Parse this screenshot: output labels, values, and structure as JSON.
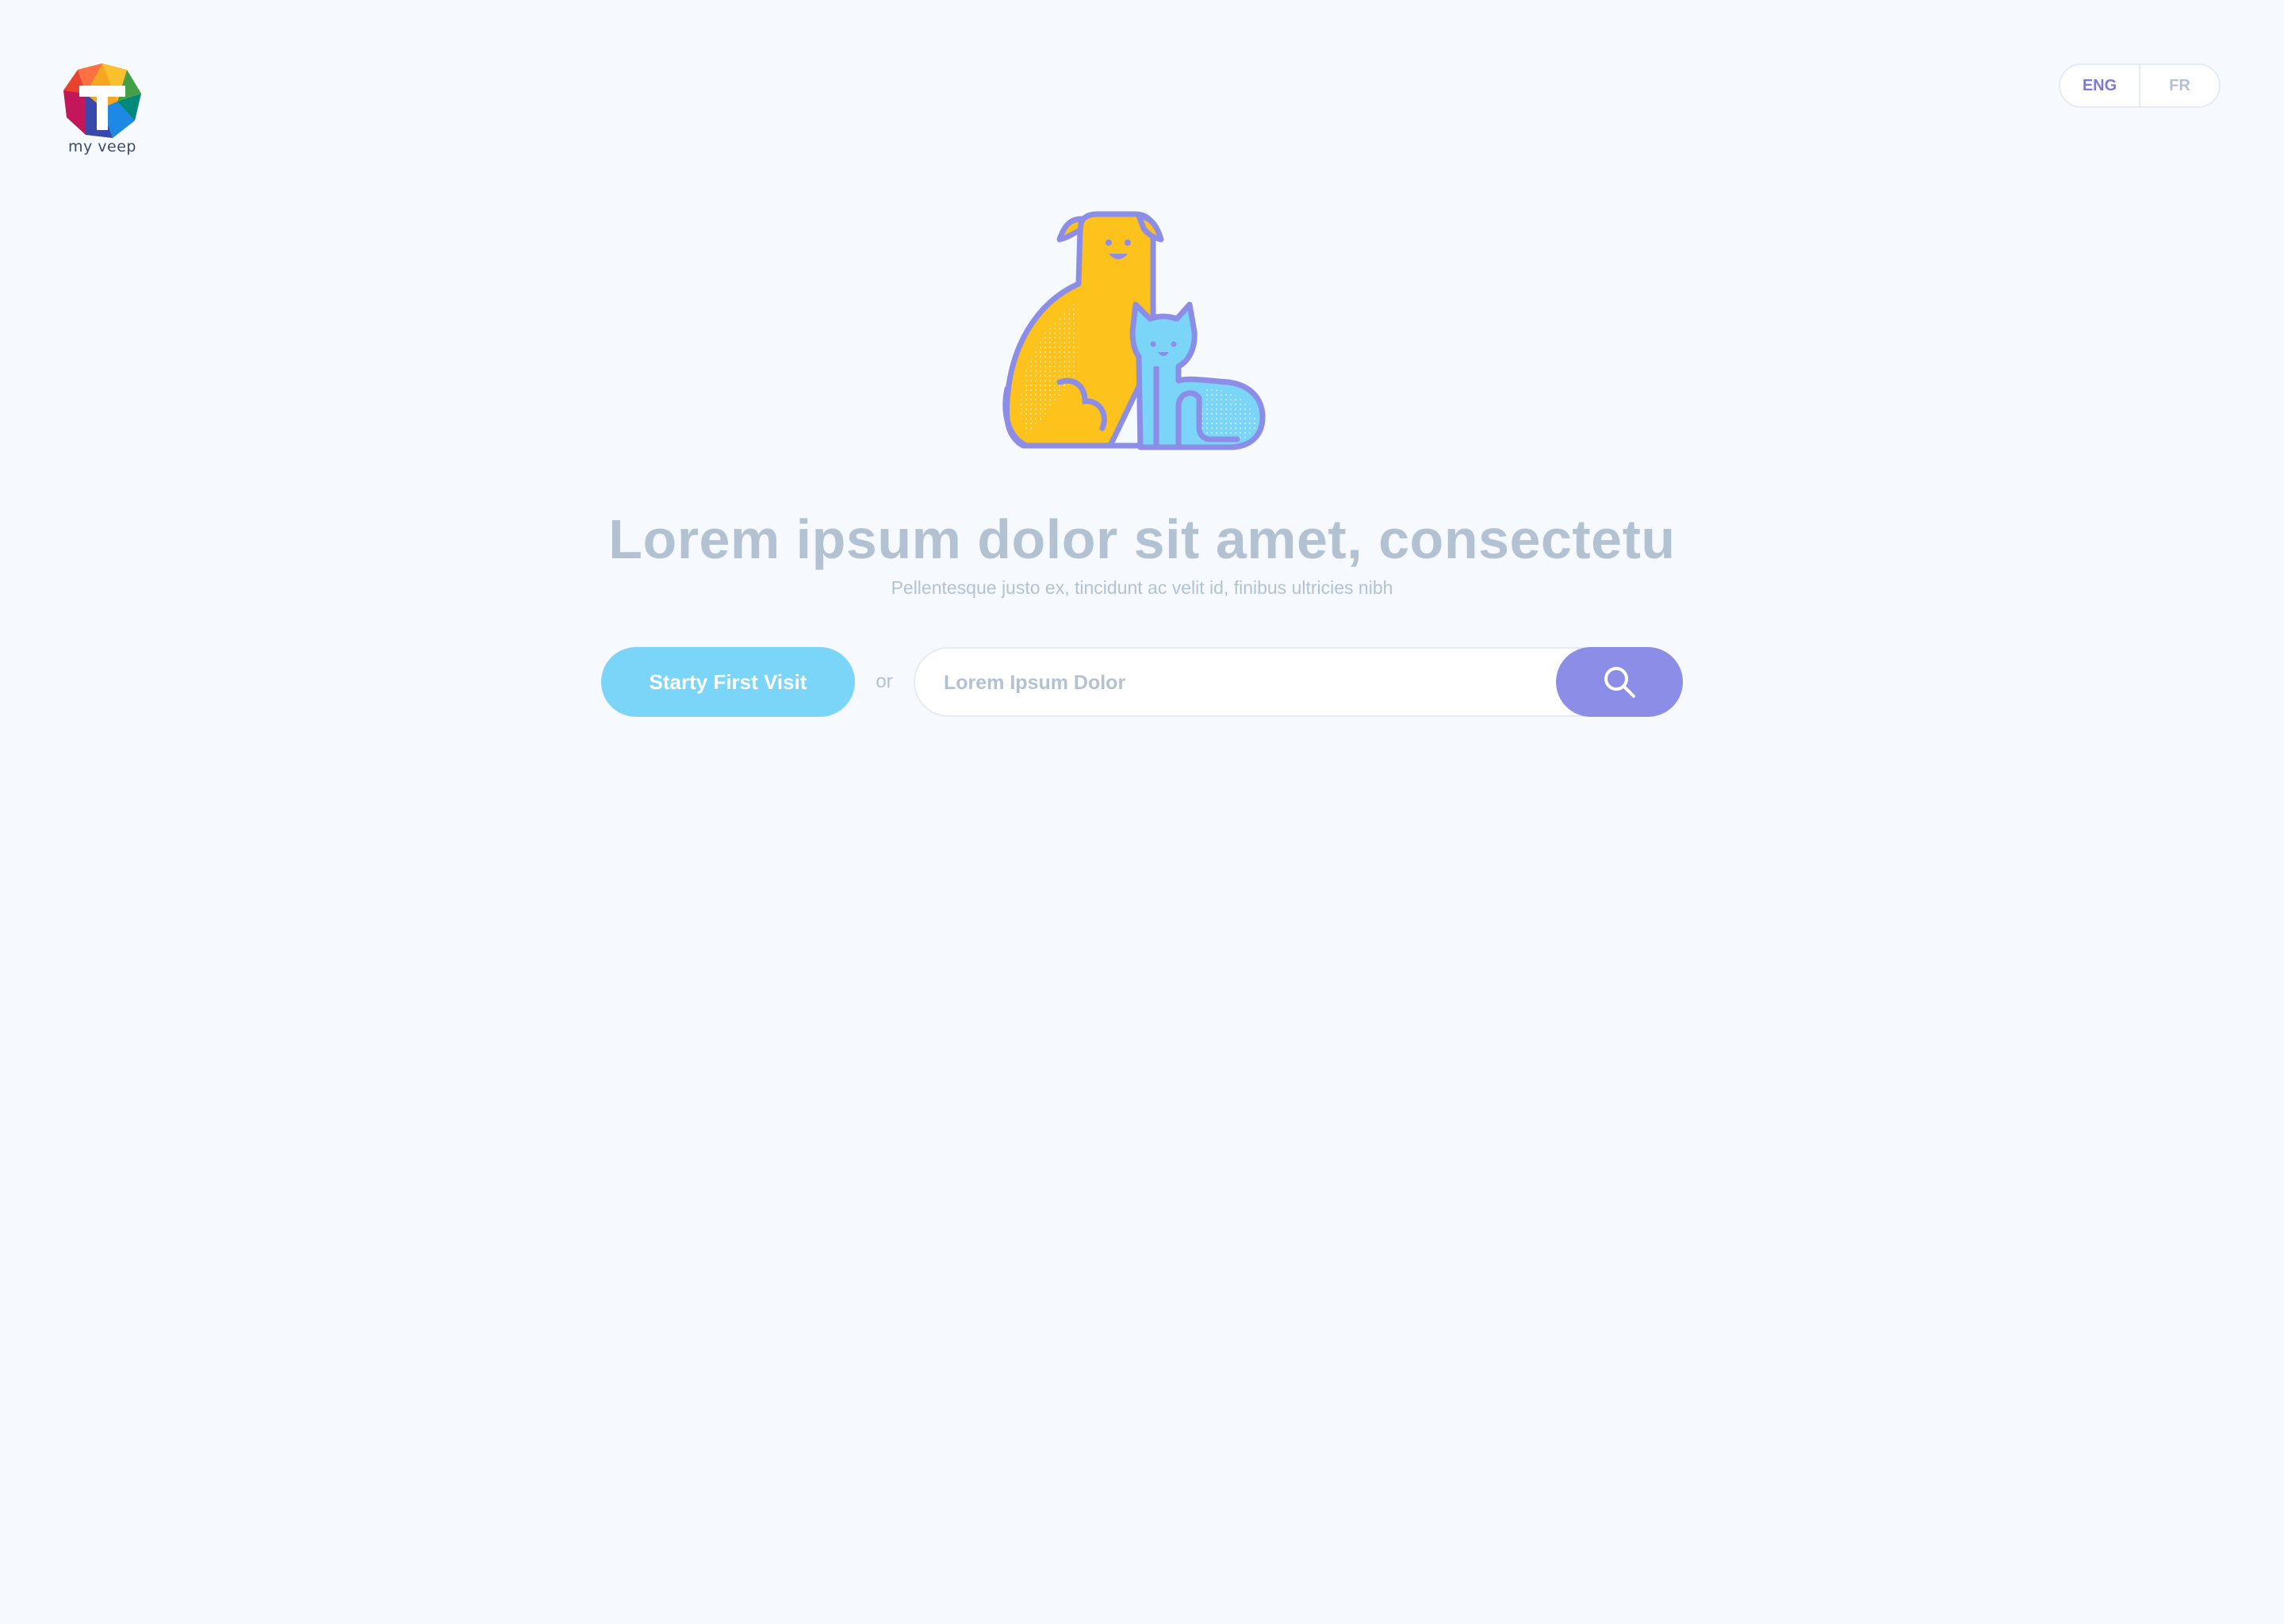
{
  "brand": {
    "name": "my veep"
  },
  "language": {
    "options": [
      "ENG",
      "FR"
    ],
    "selected": "ENG"
  },
  "hero": {
    "illustration": "dog-and-cat-illustration",
    "title": "Lorem ipsum dolor sit amet, consectetu",
    "subtitle": "Pellentesque justo ex, tincidunt ac velit id, finibus ultricies nibh"
  },
  "actions": {
    "start_label": "Starty First Visit",
    "or_label": "or",
    "search_placeholder": "Lorem Ipsum Dolor",
    "search_value": "",
    "search_icon": "search-icon"
  },
  "colors": {
    "background": "#f6f9fd",
    "start_button": "#7ad5f8",
    "search_button": "#8c8de6",
    "active_language": "#7f79d8",
    "headline": "#b3c2d3",
    "dog": "#fdc21b",
    "cat": "#7ad5f8",
    "outline": "#8c8de6"
  }
}
